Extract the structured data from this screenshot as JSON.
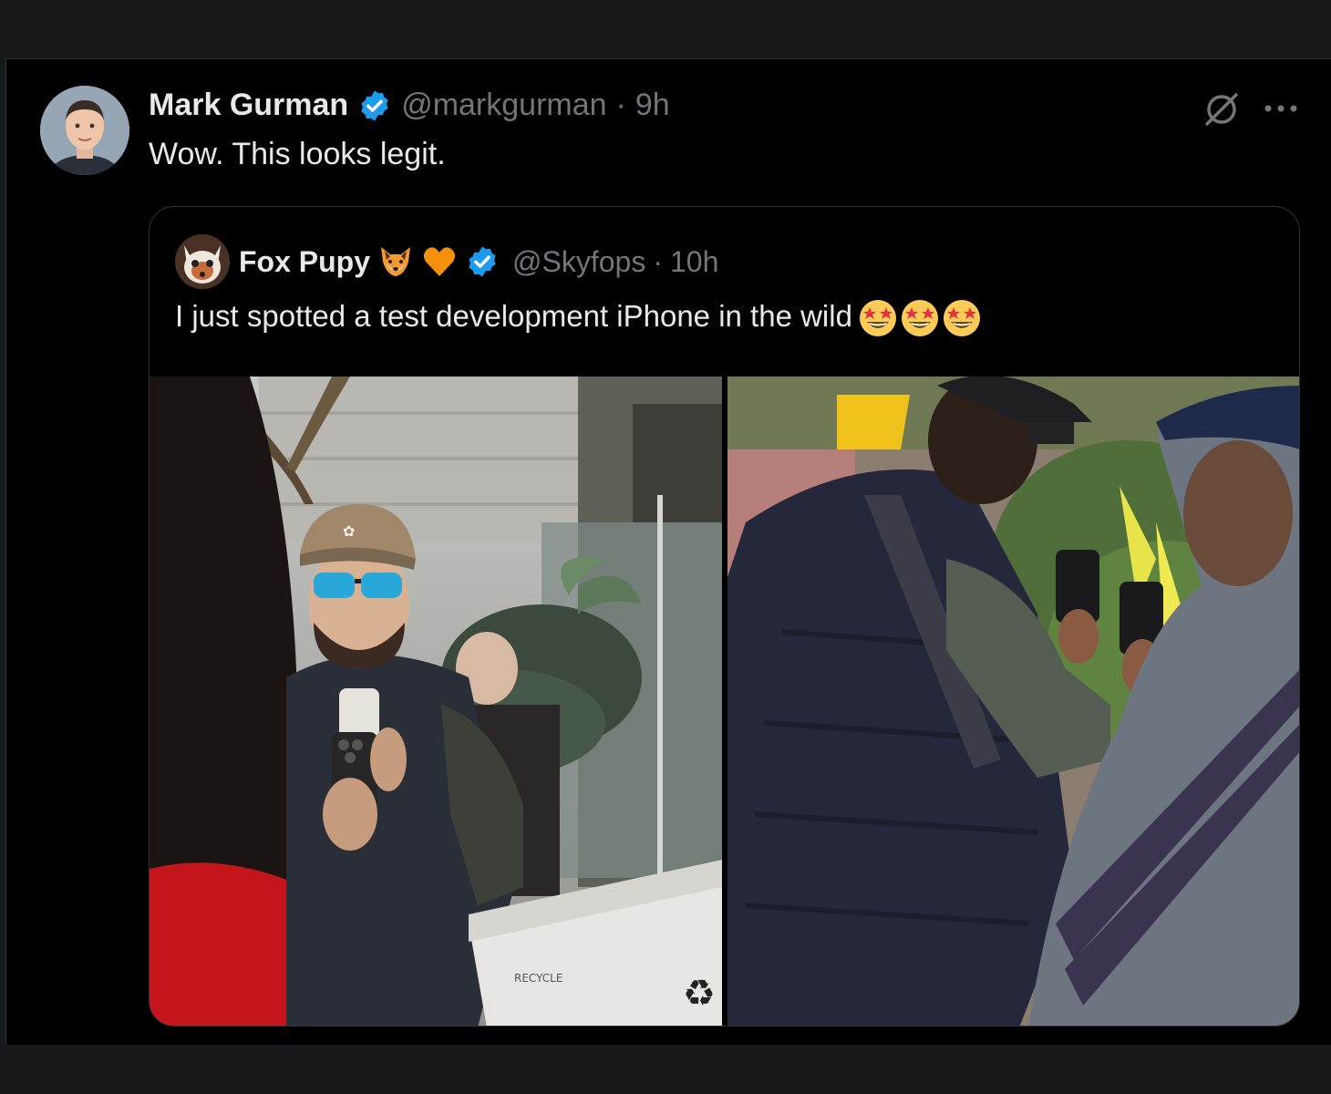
{
  "tweet": {
    "author_name": "Mark Gurman",
    "author_handle": "@markgurman",
    "separator": "·",
    "time": "9h",
    "text": "Wow. This looks legit."
  },
  "quoted_tweet": {
    "author_name": "Fox Pupy",
    "author_handle": "@Skyfops",
    "separator": "·",
    "time": "10h",
    "text": "I just spotted a test development iPhone in the wild",
    "name_emojis": [
      "fox-face-emoji",
      "orange-heart-emoji"
    ],
    "text_emojis": [
      "star-struck-emoji",
      "star-struck-emoji",
      "star-struck-emoji"
    ]
  },
  "photos": [
    {
      "name": "photo-1",
      "overlay_text": "RECYCLE"
    },
    {
      "name": "photo-2"
    }
  ],
  "colors": {
    "background": "#000000",
    "verified_blue": "#1d9bf0",
    "text_primary": "#e7e9ea",
    "text_secondary": "#71767b",
    "border": "#2f3336"
  },
  "icons": [
    "verified-badge-icon",
    "grok-icon",
    "more-icon"
  ]
}
